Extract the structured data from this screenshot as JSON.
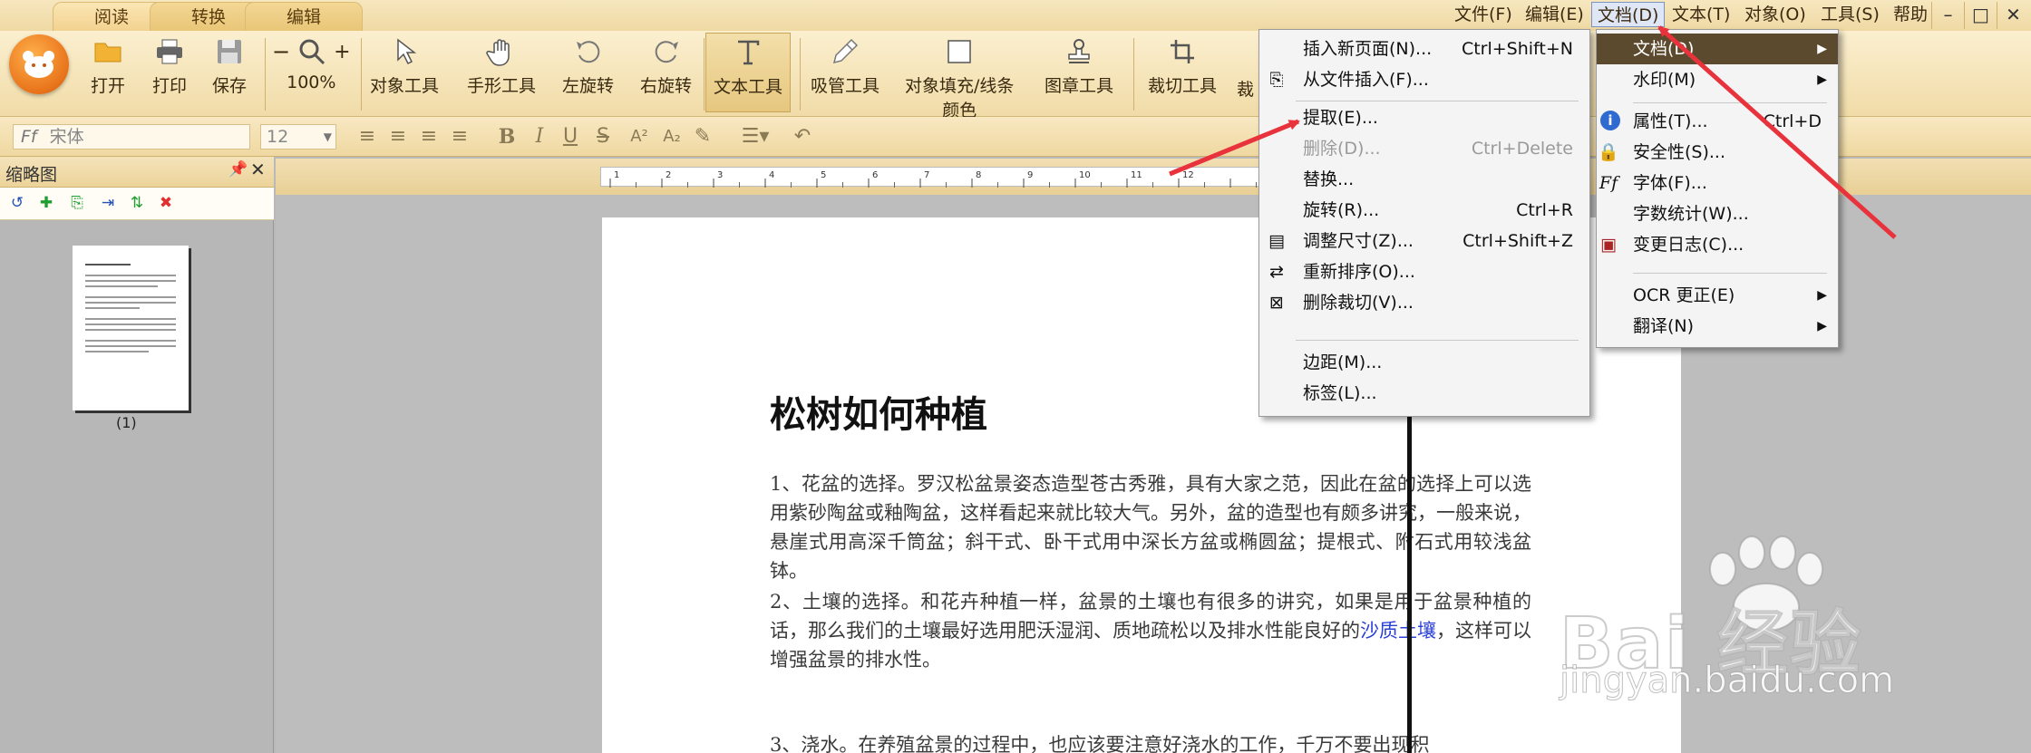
{
  "tabs": {
    "read": "阅读",
    "convert": "转换",
    "edit": "编辑"
  },
  "menubar": {
    "file": "文件(F)",
    "edit": "编辑(E)",
    "document": "文档(D)",
    "text": "文本(T)",
    "object": "对象(O)",
    "tools": "工具(S)",
    "help": "帮助"
  },
  "window_controls": {
    "minimize": "–",
    "maximize": "□",
    "close": "✕"
  },
  "toolbar": {
    "open": "打开",
    "print": "打印",
    "save": "保存",
    "zoom": "100%",
    "zoom_out": "−",
    "zoom_in": "+",
    "object_tool": "对象工具",
    "hand_tool": "手形工具",
    "rotate_left": "左旋转",
    "rotate_right": "右旋转",
    "text_tool": "文本工具",
    "eyedropper_tool": "吸管工具",
    "fill_stroke_line1": "对象填充/线条",
    "fill_stroke_line2": "颜色",
    "stamp_tool": "图章工具",
    "crop_tool": "裁切工具",
    "more_tool": "裁"
  },
  "formatbar": {
    "font_name": "宋体",
    "font_size": "12",
    "bold": "B",
    "italic": "I",
    "underline": "U",
    "strike": "S",
    "superscript": "A²",
    "subscript": "A₂"
  },
  "thumbnails": {
    "title": "缩略图",
    "page_label": "(1)"
  },
  "document": {
    "title": "松树如何种植",
    "para1": "1、花盆的选择。罗汉松盆景姿态造型苍古秀雅，具有大家之范，因此在盆的选择上可以选用紫砂陶盆或釉陶盆，这样看起来就比较大气。另外，盆的造型也有颇多讲究，一般来说，悬崖式用高深千筒盆；斜干式、卧干式用中深长方盆或椭圆盆；提根式、附石式用较浅盆钵。",
    "para2_a": "2、土壤的选择。和花卉种植一样，盆景的土壤也有很多的讲究，如果是用于盆景种植的话，那么我们的土壤最好选用肥沃湿润、质地疏松以及排水性能良好的",
    "para2_link": "沙质土壤",
    "para2_b": "，这样可以增强盆景的排水性。",
    "para3": "3、浇水。在养殖盆景的过程中，也应该要注意好浇水的工作，千万不要出现积"
  },
  "document_menu": {
    "items": [
      {
        "label": "文档(D)",
        "shortcut": "",
        "submenu": true
      },
      {
        "label": "水印(M)",
        "shortcut": "",
        "submenu": true
      },
      {
        "label": "属性(T)...",
        "shortcut": "Ctrl+D"
      },
      {
        "label": "安全性(S)...",
        "shortcut": ""
      },
      {
        "label": "字体(F)...",
        "shortcut": ""
      },
      {
        "label": "字数统计(W)...",
        "shortcut": ""
      },
      {
        "label": "变更日志(C)...",
        "shortcut": ""
      },
      {
        "label": "OCR 更正(E)",
        "shortcut": "",
        "submenu": true
      },
      {
        "label": "翻译(N)",
        "shortcut": "",
        "submenu": true
      }
    ]
  },
  "page_menu": {
    "items": [
      {
        "label": "插入新页面(N)...",
        "shortcut": "Ctrl+Shift+N"
      },
      {
        "label": "从文件插入(F)...",
        "shortcut": ""
      },
      {
        "label": "提取(E)...",
        "shortcut": ""
      },
      {
        "label": "删除(D)...",
        "shortcut": "Ctrl+Delete",
        "disabled": true
      },
      {
        "label": "替换...",
        "shortcut": ""
      },
      {
        "label": "旋转(R)...",
        "shortcut": "Ctrl+R"
      },
      {
        "label": "调整尺寸(Z)...",
        "shortcut": "Ctrl+Shift+Z"
      },
      {
        "label": "重新排序(O)...",
        "shortcut": ""
      },
      {
        "label": "删除裁切(V)...",
        "shortcut": ""
      },
      {
        "label": "边距(M)...",
        "shortcut": ""
      },
      {
        "label": "标签(L)...",
        "shortcut": ""
      }
    ]
  },
  "ruler_numbers": [
    "1",
    "2",
    "3",
    "4",
    "5",
    "6",
    "7",
    "8",
    "9",
    "10",
    "11",
    "12"
  ],
  "watermark": {
    "brand": "Bai 经验",
    "url": "jingyan.baidu.com"
  },
  "colors": {
    "accent": "#e8731a",
    "annotation_arrow": "#e8323c",
    "menu_highlight": "#5c4a2e",
    "link": "#2a3fd6"
  }
}
